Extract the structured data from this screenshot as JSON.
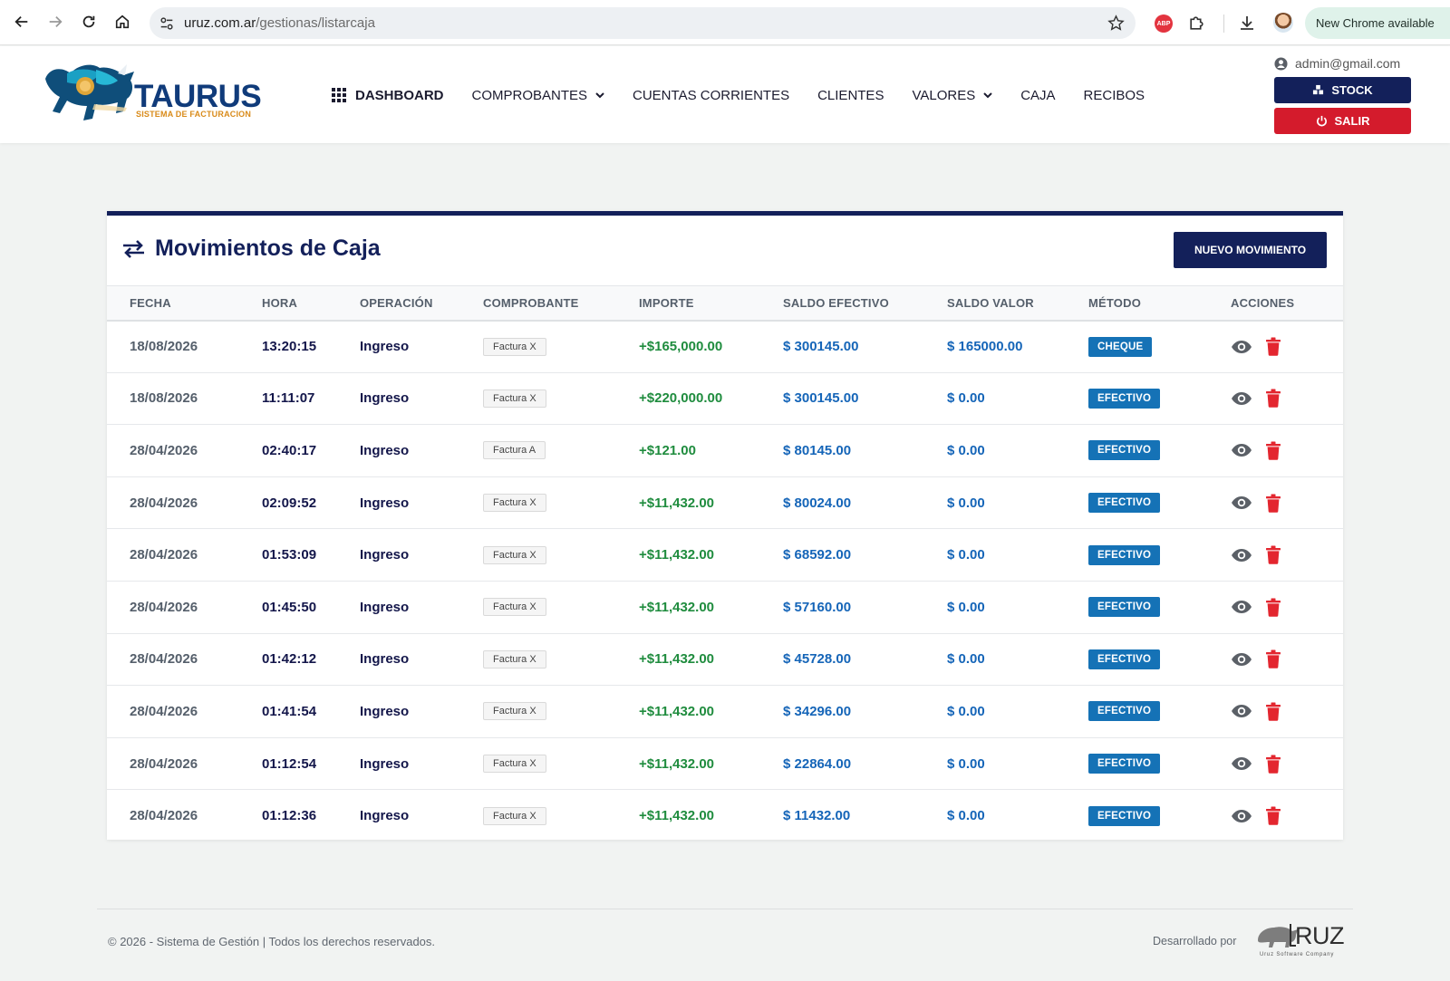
{
  "browser": {
    "url_host": "uruz.com.ar",
    "url_path": "/gestionas/listarcaja",
    "update_label": "New Chrome available",
    "abp_label": "ABP"
  },
  "header": {
    "logo_title": "TAURUS",
    "logo_subtitle": "SISTEMA DE FACTURACION",
    "nav": {
      "dashboard": "DASHBOARD",
      "comprobantes": "COMPROBANTES",
      "cuentas": "CUENTAS CORRIENTES",
      "clientes": "CLIENTES",
      "valores": "VALORES",
      "caja": "CAJA",
      "recibos": "RECIBOS"
    },
    "user_email": "admin@gmail.com",
    "stock_label": "STOCK",
    "salir_label": "SALIR"
  },
  "card": {
    "title": "Movimientos de Caja",
    "new_button": "NUEVO MOVIMIENTO",
    "columns": [
      "FECHA",
      "HORA",
      "OPERACIÓN",
      "COMPROBANTE",
      "IMPORTE",
      "SALDO EFECTIVO",
      "SALDO VALOR",
      "MÉTODO",
      "ACCIONES"
    ],
    "rows": [
      {
        "fecha": "18/08/2026",
        "hora": "13:20:15",
        "operacion": "Ingreso",
        "comprobante": "Factura X",
        "importe": "+$165,000.00",
        "saldo_efectivo": "$ 300145.00",
        "saldo_valor": "$ 165000.00",
        "metodo": "CHEQUE"
      },
      {
        "fecha": "18/08/2026",
        "hora": "11:11:07",
        "operacion": "Ingreso",
        "comprobante": "Factura X",
        "importe": "+$220,000.00",
        "saldo_efectivo": "$ 300145.00",
        "saldo_valor": "$ 0.00",
        "metodo": "EFECTIVO"
      },
      {
        "fecha": "28/04/2026",
        "hora": "02:40:17",
        "operacion": "Ingreso",
        "comprobante": "Factura A",
        "importe": "+$121.00",
        "saldo_efectivo": "$ 80145.00",
        "saldo_valor": "$ 0.00",
        "metodo": "EFECTIVO"
      },
      {
        "fecha": "28/04/2026",
        "hora": "02:09:52",
        "operacion": "Ingreso",
        "comprobante": "Factura X",
        "importe": "+$11,432.00",
        "saldo_efectivo": "$ 80024.00",
        "saldo_valor": "$ 0.00",
        "metodo": "EFECTIVO"
      },
      {
        "fecha": "28/04/2026",
        "hora": "01:53:09",
        "operacion": "Ingreso",
        "comprobante": "Factura X",
        "importe": "+$11,432.00",
        "saldo_efectivo": "$ 68592.00",
        "saldo_valor": "$ 0.00",
        "metodo": "EFECTIVO"
      },
      {
        "fecha": "28/04/2026",
        "hora": "01:45:50",
        "operacion": "Ingreso",
        "comprobante": "Factura X",
        "importe": "+$11,432.00",
        "saldo_efectivo": "$ 57160.00",
        "saldo_valor": "$ 0.00",
        "metodo": "EFECTIVO"
      },
      {
        "fecha": "28/04/2026",
        "hora": "01:42:12",
        "operacion": "Ingreso",
        "comprobante": "Factura X",
        "importe": "+$11,432.00",
        "saldo_efectivo": "$ 45728.00",
        "saldo_valor": "$ 0.00",
        "metodo": "EFECTIVO"
      },
      {
        "fecha": "28/04/2026",
        "hora": "01:41:54",
        "operacion": "Ingreso",
        "comprobante": "Factura X",
        "importe": "+$11,432.00",
        "saldo_efectivo": "$ 34296.00",
        "saldo_valor": "$ 0.00",
        "metodo": "EFECTIVO"
      },
      {
        "fecha": "28/04/2026",
        "hora": "01:12:54",
        "operacion": "Ingreso",
        "comprobante": "Factura X",
        "importe": "+$11,432.00",
        "saldo_efectivo": "$ 22864.00",
        "saldo_valor": "$ 0.00",
        "metodo": "EFECTIVO"
      },
      {
        "fecha": "28/04/2026",
        "hora": "01:12:36",
        "operacion": "Ingreso",
        "comprobante": "Factura X",
        "importe": "+$11,432.00",
        "saldo_efectivo": "$ 11432.00",
        "saldo_valor": "$ 0.00",
        "metodo": "EFECTIVO"
      }
    ]
  },
  "footer": {
    "copyright": "© 2026 - Sistema de Gestión | Todos los derechos reservados.",
    "developed_by": "Desarrollado por",
    "dev_logo_text": "RUZ",
    "dev_logo_sub": "Uruz Software Company"
  },
  "colors": {
    "brand_navy": "#13205a",
    "danger": "#d41b2c",
    "amount_green": "#1f8c3e",
    "saldo_blue": "#1565b8",
    "method_blue": "#1572b6",
    "page_bg": "#f1f3f2"
  },
  "icons": {
    "back": "arrow-left-icon",
    "forward": "arrow-right-icon",
    "reload": "reload-icon",
    "home": "home-icon",
    "site_settings": "tune-icon",
    "bookmark": "star-icon",
    "extensions": "puzzle-icon",
    "downloads": "download-icon",
    "dashboard": "grid-icon",
    "dropdown": "chevron-down-icon",
    "user": "user-circle-icon",
    "stock": "boxes-icon",
    "logout": "power-icon",
    "title": "exchange-arrows-icon",
    "view": "eye-icon",
    "delete": "trash-icon"
  }
}
